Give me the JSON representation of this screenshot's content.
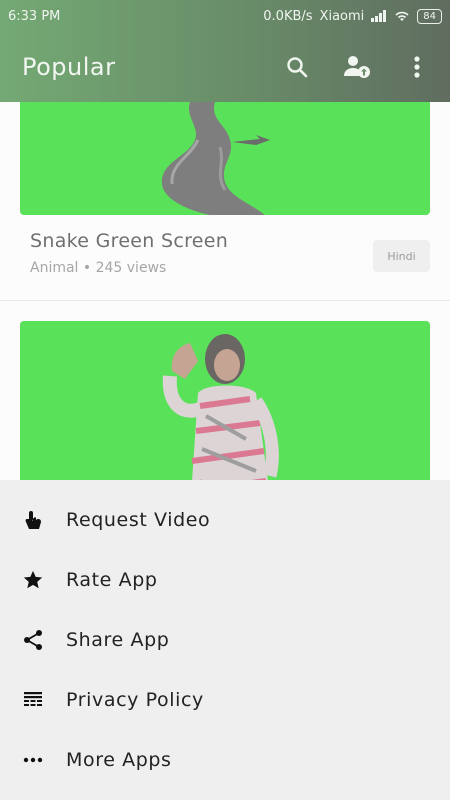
{
  "status_bar": {
    "time": "6:33 PM",
    "network_speed": "0.0KB/s",
    "carrier": "Xiaomi",
    "battery": "84"
  },
  "app_bar": {
    "title": "Popular",
    "icons": [
      "search-icon",
      "account-upload-icon",
      "more-vert-icon"
    ]
  },
  "videos": [
    {
      "title": "Snake Green Screen",
      "category": "Animal",
      "views": "245 views",
      "meta": "Animal • 245 views",
      "language": "Hindi",
      "thumbnail_color": "#00d100"
    },
    {
      "thumbnail_color": "#00d100"
    }
  ],
  "menu": {
    "items": [
      {
        "label": "Request Video",
        "icon": "touch-icon"
      },
      {
        "label": "Rate App",
        "icon": "star-icon"
      },
      {
        "label": "Share App",
        "icon": "share-icon"
      },
      {
        "label": "Privacy Policy",
        "icon": "policy-icon"
      },
      {
        "label": "More Apps",
        "icon": "more-horiz-icon"
      }
    ]
  },
  "colors": {
    "app_bar_start": "#2a7b2a",
    "app_bar_end": "#0b1f0b",
    "green_screen": "#00d100",
    "sheet_background": "#efefef"
  }
}
